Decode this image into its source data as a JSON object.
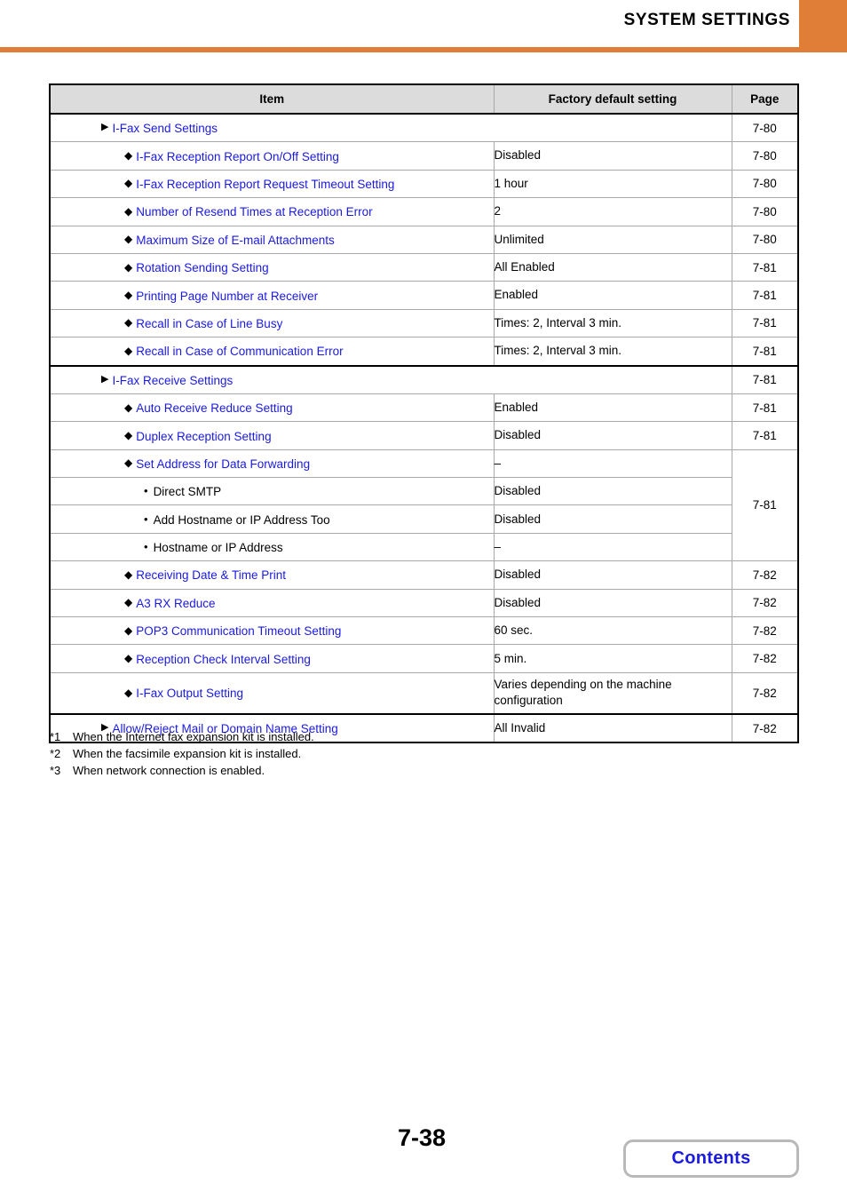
{
  "header": {
    "title": "SYSTEM SETTINGS",
    "accent_color": "#e07d36"
  },
  "table": {
    "columns": [
      "Item",
      "Factory default setting",
      "Page"
    ],
    "link_color": "#1a1ae0",
    "header_bg": "#dcdcdc",
    "rows": [
      {
        "level": 1,
        "marker": "triangle",
        "item": "I-Fax Send Settings",
        "link": true,
        "value": null,
        "merged_item_value": true,
        "page": "7-80"
      },
      {
        "level": 2,
        "marker": "diamond",
        "item": "I-Fax Reception Report On/Off Setting",
        "link": true,
        "value": "Disabled",
        "page": "7-80"
      },
      {
        "level": 2,
        "marker": "diamond",
        "item": "I-Fax Reception Report Request Timeout Setting",
        "link": true,
        "value": "1 hour",
        "page": "7-80"
      },
      {
        "level": 2,
        "marker": "diamond",
        "item": "Number of Resend Times at Reception Error",
        "link": true,
        "value": "2",
        "page": "7-80"
      },
      {
        "level": 2,
        "marker": "diamond",
        "item": "Maximum Size of E-mail Attachments",
        "link": true,
        "value": "Unlimited",
        "page": "7-80"
      },
      {
        "level": 2,
        "marker": "diamond",
        "item": "Rotation Sending Setting",
        "link": true,
        "value": "All Enabled",
        "page": "7-81"
      },
      {
        "level": 2,
        "marker": "diamond",
        "item": "Printing Page Number at Receiver",
        "link": true,
        "value": "Enabled",
        "page": "7-81"
      },
      {
        "level": 2,
        "marker": "diamond",
        "item": "Recall in Case of Line Busy",
        "link": true,
        "value": "Times: 2, Interval 3 min.",
        "page": "7-81"
      },
      {
        "level": 2,
        "marker": "diamond",
        "item": "Recall in Case of Communication Error",
        "link": true,
        "value": "Times: 2, Interval 3 min.",
        "page": "7-81"
      },
      {
        "level": 1,
        "marker": "triangle",
        "item": "I-Fax Receive Settings",
        "link": true,
        "value": null,
        "merged_item_value": true,
        "page": "7-81"
      },
      {
        "level": 2,
        "marker": "diamond",
        "item": "Auto Receive Reduce Setting",
        "link": true,
        "value": "Enabled",
        "page": "7-81"
      },
      {
        "level": 2,
        "marker": "diamond",
        "item": "Duplex Reception Setting",
        "link": true,
        "value": "Disabled",
        "page": "7-81"
      },
      {
        "level": 2,
        "marker": "diamond",
        "item": "Set Address for Data Forwarding",
        "link": true,
        "value": "–",
        "page": "7-81",
        "page_rowspan": 4
      },
      {
        "level": 3,
        "marker": "bullet",
        "item": "Direct SMTP",
        "link": false,
        "value": "Disabled",
        "page": null
      },
      {
        "level": 3,
        "marker": "bullet",
        "item": "Add Hostname or IP Address Too",
        "link": false,
        "value": "Disabled",
        "page": null
      },
      {
        "level": 3,
        "marker": "bullet",
        "item": "Hostname or IP Address",
        "link": false,
        "value": "–",
        "page": null
      },
      {
        "level": 2,
        "marker": "diamond",
        "item": "Receiving Date & Time Print",
        "link": true,
        "value": "Disabled",
        "page": "7-82"
      },
      {
        "level": 2,
        "marker": "diamond",
        "item": "A3 RX Reduce",
        "link": true,
        "value": "Disabled",
        "page": "7-82"
      },
      {
        "level": 2,
        "marker": "diamond",
        "item": "POP3 Communication Timeout Setting",
        "link": true,
        "value": "60 sec.",
        "page": "7-82"
      },
      {
        "level": 2,
        "marker": "diamond",
        "item": "Reception Check Interval Setting",
        "link": true,
        "value": "5 min.",
        "page": "7-82"
      },
      {
        "level": 2,
        "marker": "diamond",
        "item": "I-Fax Output Setting",
        "link": true,
        "value": "Varies depending on the machine configuration",
        "page": "7-82",
        "tall": true
      },
      {
        "level": 1,
        "marker": "triangle",
        "item": "Allow/Reject Mail or Domain Name Setting",
        "link": true,
        "value": "All Invalid",
        "page": "7-82"
      }
    ]
  },
  "footnotes": [
    {
      "mark": "*1",
      "text": "When the Internet fax expansion kit is installed."
    },
    {
      "mark": "*2",
      "text": "When the facsimile expansion kit is installed."
    },
    {
      "mark": "*3",
      "text": "When network connection is enabled."
    }
  ],
  "footer": {
    "page_number": "7-38",
    "contents_label": "Contents"
  }
}
